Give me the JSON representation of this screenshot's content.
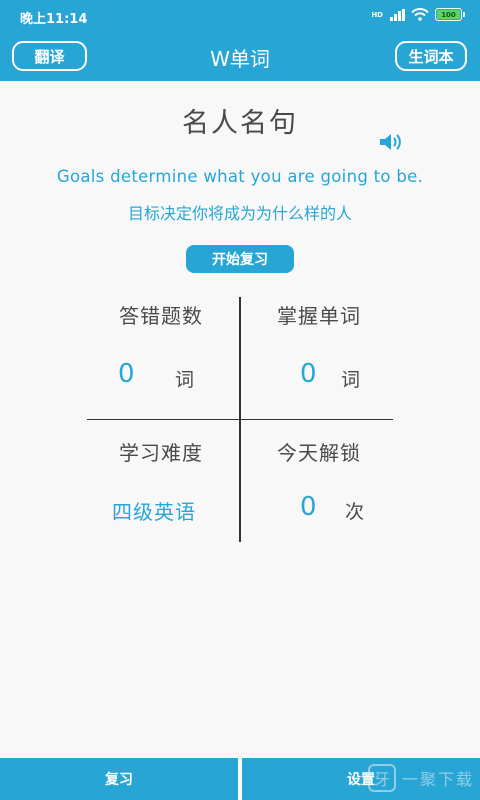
{
  "status_bar": {
    "time": "晚上11:14",
    "network": "HD",
    "battery": "100"
  },
  "nav": {
    "left_button": "翻译",
    "title": "W单词",
    "right_button": "生词本"
  },
  "quote": {
    "title": "名人名句",
    "english": "Goals determine what you are going to be.",
    "chinese": "目标决定你将成为为什么样的人",
    "speaker_icon": "speaker-icon"
  },
  "review_button": "开始复习",
  "stats": {
    "wrong_count": {
      "label": "答错题数",
      "value": "0",
      "unit": "词"
    },
    "mastered": {
      "label": "掌握单词",
      "value": "0",
      "unit": "词"
    },
    "difficulty": {
      "label": "学习难度",
      "value": "四级英语"
    },
    "unlock_today": {
      "label": "今天解锁",
      "value": "0",
      "unit": "次"
    }
  },
  "bottom_bar": {
    "left": "复习",
    "right": "设置"
  },
  "watermark": {
    "logo": "牙",
    "text": "一聚下载"
  },
  "colors": {
    "accent": "#27a6d6",
    "text": "#4a4a4a",
    "background": "#f8f8f8"
  }
}
